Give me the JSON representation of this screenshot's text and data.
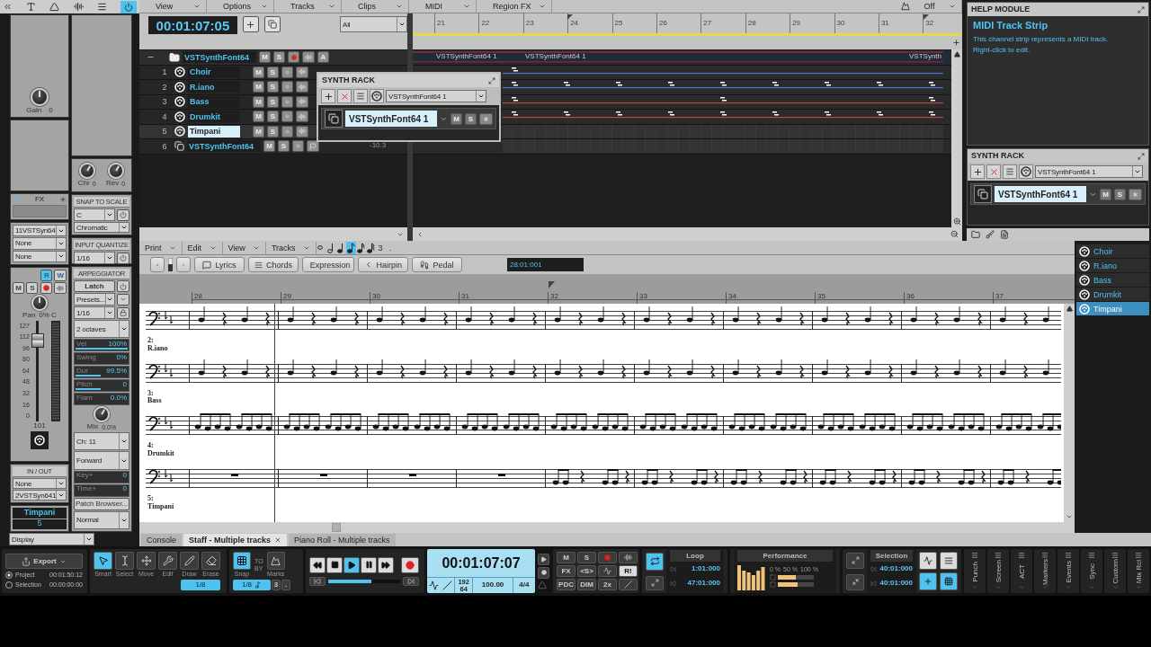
{
  "inspector": {
    "gain": {
      "label": "Gain",
      "value": "0"
    },
    "knobs": [
      {
        "label": "Chr",
        "value": "0"
      },
      {
        "label": "Rev",
        "value": "0"
      }
    ],
    "fx": {
      "title": "FX"
    },
    "routing": [
      "11VSTSyn64",
      "None",
      "None"
    ],
    "snap_to_scale": {
      "title": "SNAP TO SCALE",
      "key": "C",
      "scale": "Chromatic"
    },
    "input_quantize": {
      "title": "INPUT QUANTIZE",
      "value": "1/16"
    },
    "arpeggiator": {
      "title": "ARPEGGIATOR",
      "latch": "Latch",
      "presets": "Presets...",
      "rate": "1/16",
      "range": "2 octaves",
      "params": [
        {
          "label": "Vel",
          "value": "100%",
          "level": 1
        },
        {
          "label": "Swing",
          "value": "0%"
        },
        {
          "label": "Dur",
          "value": "99.5%",
          "level": 0.5
        },
        {
          "label": "Pitch",
          "value": "0",
          "level": 0.5
        },
        {
          "label": "Flam",
          "value": "0.0%"
        }
      ],
      "mix": {
        "label": "Mix",
        "value": "0.0%"
      },
      "channel": "Ch: 11",
      "direction": "Forward",
      "offsets": [
        {
          "label": "Key+",
          "value": "0"
        },
        {
          "label": "Time+",
          "value": "0"
        }
      ],
      "patch_browser": "Patch Browser...",
      "mode": "Normal"
    },
    "strip": {
      "toggles": [
        {
          "label": "R",
          "on": true
        },
        {
          "label": "W",
          "on": false
        }
      ],
      "mute": "M",
      "solo": "S",
      "pan": {
        "label": "Pan",
        "value": "0% C"
      },
      "scale": [
        "127",
        "112",
        "96",
        "80",
        "64",
        "48",
        "32",
        "16",
        "0"
      ],
      "fader": {
        "level": 0.8,
        "value": "101"
      }
    },
    "in_out": {
      "title": "IN / OUT",
      "input": "None",
      "output": "2VSTSyn641"
    },
    "track_name": "Timpani",
    "track_number": "5",
    "display": "Display"
  },
  "track_view": {
    "menus": [
      "View",
      "Options",
      "Tracks",
      "Clips",
      "MIDI",
      "Region FX"
    ],
    "time": "00:01:07:05",
    "filter": "All",
    "snap": "Off",
    "ruler": [
      "21",
      "22",
      "23",
      "24",
      "25",
      "26",
      "27",
      "28",
      "29",
      "30",
      "31",
      "32"
    ],
    "folder": {
      "name": "VSTSynthFont64",
      "buttons": [
        "M",
        "S"
      ],
      "auto": "A"
    },
    "tracks": [
      {
        "number": "1",
        "name": "Choir",
        "kind": "midi",
        "selected": false,
        "buttons": [
          "M",
          "S"
        ]
      },
      {
        "number": "2",
        "name": "R.iano",
        "kind": "midi",
        "selected": false,
        "buttons": [
          "M",
          "S"
        ]
      },
      {
        "number": "3",
        "name": "Bass",
        "kind": "midi",
        "selected": false,
        "buttons": [
          "M",
          "S"
        ]
      },
      {
        "number": "4",
        "name": "Drumkit",
        "kind": "midi",
        "selected": false,
        "buttons": [
          "M",
          "S"
        ]
      },
      {
        "number": "5",
        "name": "Timpani",
        "kind": "midi",
        "selected": true,
        "buttons": [
          "M",
          "S"
        ]
      },
      {
        "number": "6",
        "name": "VSTSynthFont64",
        "kind": "synth",
        "selected": false,
        "buttons": [
          "M",
          "S"
        ]
      }
    ],
    "volume": "-10.3",
    "clip_labels": [
      "VSTSynthFont64 1",
      "VSTSynthFont64 1",
      "VSTSynth"
    ],
    "synth_rack_popup": {
      "title": "SYNTH RACK",
      "selector": "VSTSynthFont64 1",
      "instrument": "VSTSynthFont64 1",
      "buttons": [
        "M",
        "S"
      ]
    }
  },
  "help": {
    "title": "HELP MODULE",
    "heading": "MIDI Track Strip",
    "lines": [
      "This channel strip represents a MIDI track.",
      "Right-click to edit."
    ]
  },
  "synth_rack": {
    "title": "SYNTH RACK",
    "selector": "VSTSynthFont64 1",
    "instrument": "VSTSynthFont64 1",
    "buttons": [
      "M",
      "S"
    ]
  },
  "staff": {
    "menus": [
      "Print",
      "Edit",
      "View",
      "Tracks"
    ],
    "durations": [
      {
        "kind": "whole",
        "selected": false
      },
      {
        "kind": "half",
        "selected": false
      },
      {
        "kind": "quarter",
        "selected": false
      },
      {
        "kind": "eighth",
        "selected": true
      },
      {
        "kind": "sixteenth",
        "selected": false
      },
      {
        "kind": "thirtysecond",
        "selected": false
      }
    ],
    "tuplet": "3",
    "dot": ".",
    "tools": [
      {
        "kind": "lyrics",
        "label": "Lyrics"
      },
      {
        "kind": "chords",
        "label": "Chords"
      },
      {
        "kind": "expression",
        "label": "Expression"
      },
      {
        "kind": "hairpin",
        "label": "Hairpin"
      },
      {
        "kind": "pedal",
        "label": "Pedal"
      }
    ],
    "position": "28:01:001",
    "ruler": [
      "28",
      "29",
      "30",
      "31",
      "32",
      "33",
      "34",
      "35",
      "36",
      "37"
    ],
    "staves": [
      {
        "kind": "quarters",
        "number": "2:",
        "name": "R.iano"
      },
      {
        "kind": "quarters",
        "number": "3:",
        "name": "Bass"
      },
      {
        "kind": "eighths",
        "number": "4:",
        "name": "Drumkit"
      },
      {
        "kind": "sparse",
        "number": "5:",
        "name": "Timpani"
      }
    ],
    "track_list": [
      {
        "name": "Choir",
        "selected": false
      },
      {
        "name": "R.iano",
        "selected": false
      },
      {
        "name": "Bass",
        "selected": false
      },
      {
        "name": "Drumkit",
        "selected": false
      },
      {
        "name": "Timpani",
        "selected": true
      }
    ]
  },
  "tabs": [
    {
      "label": "Console",
      "selected": false,
      "closable": false
    },
    {
      "label": "Staff - Multiple tracks",
      "selected": true,
      "closable": true
    },
    {
      "label": "Piano Roll - Multiple tracks",
      "selected": false,
      "closable": false
    }
  ],
  "control_bar": {
    "export": {
      "label": "Export",
      "rows": [
        {
          "label": "Project",
          "value": "00:01:50:12",
          "selected": true
        },
        {
          "label": "Selection",
          "value": "00:00:00:00",
          "selected": false
        }
      ]
    },
    "tools": [
      {
        "kind": "smart",
        "label": "Smart",
        "selected": true
      },
      {
        "kind": "select",
        "label": "Select",
        "selected": false
      },
      {
        "kind": "move",
        "label": "Move",
        "selected": false
      },
      {
        "kind": "edit",
        "label": "Edit",
        "selected": false
      },
      {
        "kind": "draw",
        "label": "Draw",
        "selected": false
      },
      {
        "kind": "erase",
        "label": "Erase",
        "selected": false
      }
    ],
    "tool_resolution": "1/8",
    "snap": {
      "label": "Snap",
      "on": true,
      "modes": [
        "TO",
        "BY"
      ],
      "marks": "Marks",
      "value": "1/8",
      "tuplet": "3",
      "dot": "."
    },
    "transport": {
      "playing": true,
      "position": {
        "level": 0.6
      },
      "time": "00:01:07:07",
      "ppq": [
        "192",
        "64"
      ],
      "tempo": "100.00",
      "meter": "4/4"
    },
    "mix_buttons": [
      {
        "kind": "text",
        "label": "M",
        "on": false
      },
      {
        "kind": "text",
        "label": "S",
        "on": false
      },
      {
        "kind": "record",
        "on": false
      },
      {
        "kind": "echo",
        "on": false
      },
      {
        "kind": "text",
        "label": "FX",
        "on": false
      },
      {
        "kind": "text",
        "label": "<S>",
        "on": false
      },
      {
        "kind": "sync",
        "on": false
      },
      {
        "kind": "text",
        "label": "R!",
        "on": true
      },
      {
        "kind": "text",
        "label": "PDC",
        "on": false
      },
      {
        "kind": "text",
        "label": "DIM",
        "on": false
      },
      {
        "kind": "text",
        "label": "2x",
        "on": false
      },
      {
        "kind": "off",
        "on": false
      }
    ],
    "loop": {
      "label": "Loop",
      "on": true,
      "start": "1:01:000",
      "end": "47:01:000"
    },
    "performance": {
      "label": "Performance",
      "scale": [
        "0 %",
        "50 %",
        "100 %"
      ],
      "meters": [
        {
          "level": 0.5
        },
        {
          "level": 0.55
        }
      ]
    },
    "selection": {
      "label": "Selection",
      "start": "40:01:000",
      "end": "40:01:000"
    },
    "side_tabs": [
      "Punch",
      "Screen",
      "ACT",
      "Markers",
      "Events",
      "Sync",
      "Custom",
      "Mix Rcl"
    ]
  }
}
